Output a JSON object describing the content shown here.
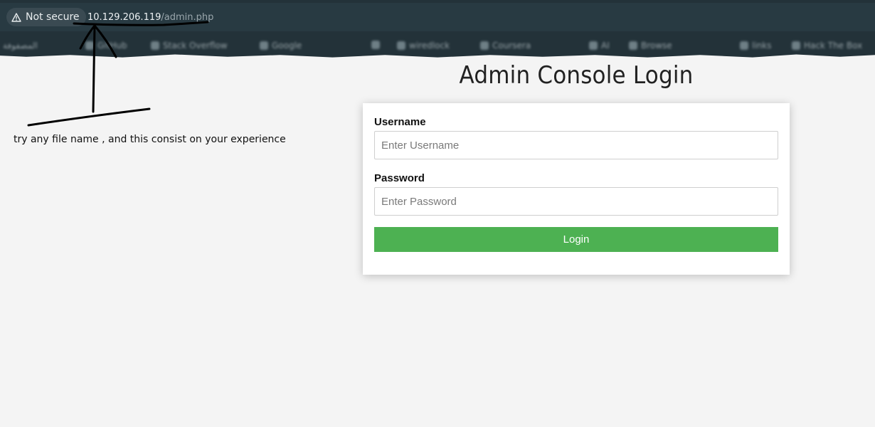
{
  "browser": {
    "security_label": "Not secure",
    "url_host": "10.129.206.119",
    "url_path": "/admin.php",
    "bookmarks": [
      "المصفوفة",
      "GitHub",
      "Stack Overflow",
      "Google",
      "",
      "wiredlock",
      "Coursera",
      "AI",
      "Browse",
      "links",
      "Hack The Box"
    ]
  },
  "annotation": {
    "note": "try any file name , and this consist on your experience"
  },
  "page": {
    "title": "Admin Console Login"
  },
  "login_form": {
    "username_label": "Username",
    "username_placeholder": "Enter Username",
    "password_label": "Password",
    "password_placeholder": "Enter Password",
    "submit_label": "Login"
  },
  "colors": {
    "chrome": "#233239",
    "login_button": "#4db152",
    "page_background": "#f4f4f4"
  }
}
